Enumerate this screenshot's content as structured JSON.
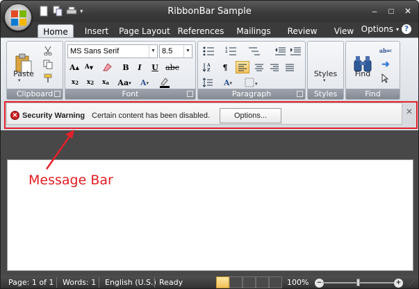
{
  "window": {
    "title": "RibbonBar Sample"
  },
  "tabs": [
    "Home",
    "Insert",
    "Page Layout",
    "References",
    "Mailings",
    "Review",
    "View"
  ],
  "options_label": "Options",
  "help_glyph": "?",
  "clipboard": {
    "paste_label": "Paste",
    "group_label": "Clipboard"
  },
  "font": {
    "name": "MS Sans Serif",
    "size": "8.5",
    "group_label": "Font",
    "bold": "B",
    "italic": "I",
    "underline": "U",
    "strike": "abc",
    "grow": "A",
    "shrink": "A",
    "change_case": "Aa",
    "font_color": "A"
  },
  "paragraph": {
    "group_label": "Paragraph",
    "pilcrow": "¶"
  },
  "styles": {
    "label": "Styles",
    "group_label": "Styles"
  },
  "find": {
    "label": "Find",
    "group_label": "Find"
  },
  "message_bar": {
    "title": "Security Warning",
    "text": "Certain content has been disabled.",
    "button": "Options..."
  },
  "annotation": "Message Bar",
  "status": {
    "page": "Page: 1 of 1",
    "words": "Words: 1",
    "language": "English (U.S.)",
    "ready": "Ready",
    "zoom": "100%"
  },
  "colors": {
    "highlight": "#e3202a",
    "accent": "#f2c158"
  }
}
